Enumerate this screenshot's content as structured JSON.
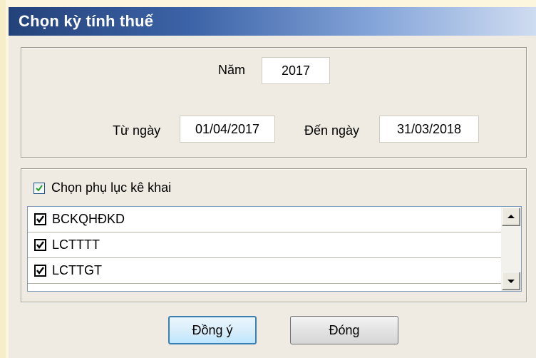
{
  "dialog": {
    "title": "Chọn kỳ tính thuế"
  },
  "period": {
    "year_label": "Năm",
    "year_value": "2017",
    "from_label": "Từ ngày",
    "from_value": "01/04/2017",
    "to_label": "Đến ngày",
    "to_value": "31/03/2018"
  },
  "appendix": {
    "select_label": "Chọn phụ lục kê khai",
    "select_checked": true,
    "items": [
      {
        "label": "BCKQHĐKD",
        "checked": true
      },
      {
        "label": "LCTTTT",
        "checked": true
      },
      {
        "label": "LCTTGT",
        "checked": true
      }
    ]
  },
  "buttons": {
    "ok_label": "Đồng ý",
    "close_label": "Đóng"
  },
  "colors": {
    "title_start": "#24427a",
    "title_end": "#cfdcf1",
    "panel": "#efebe3",
    "page": "#fbf6dd"
  }
}
